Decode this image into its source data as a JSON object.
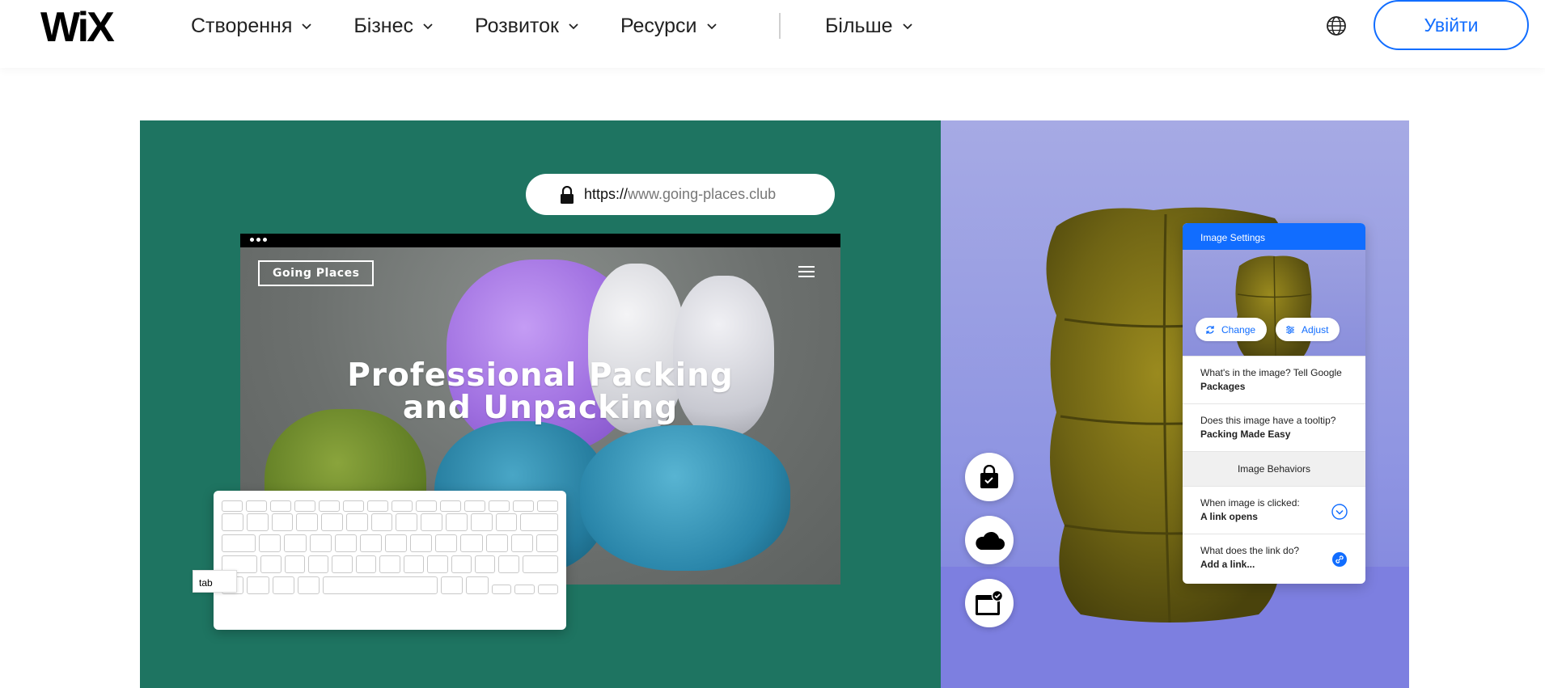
{
  "header": {
    "logo": "WiX",
    "nav": [
      {
        "label": "Створення"
      },
      {
        "label": "Бізнес"
      },
      {
        "label": "Розвиток"
      },
      {
        "label": "Ресурси"
      }
    ],
    "more_label": "Більше",
    "login_label": "Увійти"
  },
  "hero": {
    "url_proto": "https://",
    "url_domain": "www.going-places.club",
    "site_logo": "Going Places",
    "headline_line1": "Professional Packing",
    "headline_line2": "and Unpacking",
    "tab_key_label": "tab"
  },
  "panel": {
    "title": "Image Settings",
    "change_label": "Change",
    "adjust_label": "Adjust",
    "rows": [
      {
        "q": "What's in the image? Tell Google",
        "a": "Packages"
      },
      {
        "q": "Does this image have a tooltip?",
        "a": "Packing Made Easy"
      }
    ],
    "behaviors_label": "Image Behaviors",
    "click_q": "When image is clicked:",
    "click_a": "A link opens",
    "link_q": "What does the link do?",
    "link_a": "Add a link..."
  },
  "colors": {
    "brand_blue": "#116dff",
    "hero_green": "#1e7461",
    "hero_purple": "#8f95e2"
  },
  "icons": [
    "chevron-down-icon",
    "globe-icon",
    "lock-icon",
    "menu-icon",
    "bag-lock-icon",
    "cloud-icon",
    "browser-check-icon",
    "refresh-icon",
    "sliders-icon",
    "chevron-circle-icon",
    "link-icon"
  ]
}
